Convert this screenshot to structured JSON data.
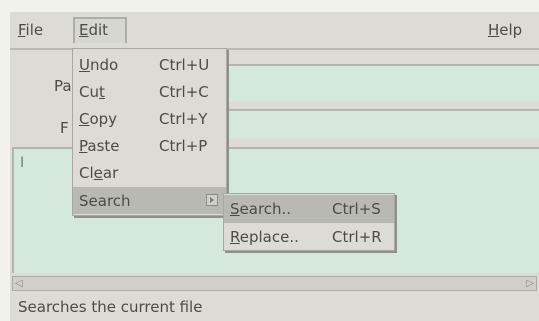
{
  "menubar": {
    "file": {
      "mn": "F",
      "rest": "ile"
    },
    "edit": {
      "mn": "E",
      "rest": "dit"
    },
    "help": {
      "mn": "H",
      "rest": "elp"
    }
  },
  "form": {
    "field1_label_fragment": "Pa",
    "field2_label_fragment": "F"
  },
  "edit_menu": {
    "undo": {
      "pre": "",
      "mn": "U",
      "post": "ndo",
      "shortcut": "Ctrl+U"
    },
    "cut": {
      "pre": "Cu",
      "mn": "t",
      "post": "",
      "shortcut": "Ctrl+C"
    },
    "copy": {
      "pre": "",
      "mn": "C",
      "post": "opy",
      "shortcut": "Ctrl+Y"
    },
    "paste": {
      "pre": "",
      "mn": "P",
      "post": "aste",
      "shortcut": "Ctrl+P"
    },
    "clear": {
      "pre": "Cl",
      "mn": "e",
      "post": "ar"
    },
    "search": {
      "label": "Search"
    }
  },
  "search_submenu": {
    "search": {
      "pre": "",
      "mn": "S",
      "post": "earch..",
      "shortcut": "Ctrl+S"
    },
    "replace": {
      "pre": "",
      "mn": "R",
      "post": "eplace..",
      "shortcut": "Ctrl+R"
    }
  },
  "status_text": "Searches the current file"
}
